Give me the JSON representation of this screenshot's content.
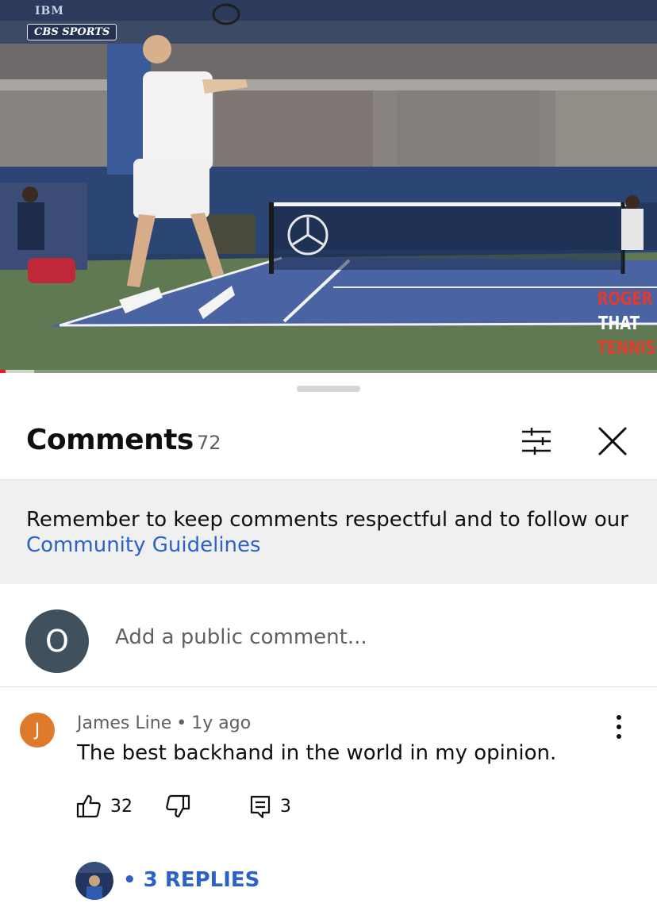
{
  "video": {
    "broadcaster_logo": "IBM",
    "network_bug": "CBS SPORTS",
    "watermark_lines": [
      "ROGER",
      "THAT",
      "TENNIS"
    ],
    "progress_played_fraction": 0.008,
    "progress_buffered_fraction": 0.052
  },
  "comments_panel": {
    "title": "Comments",
    "count": "72",
    "filter_icon": "sliders-icon",
    "close_icon": "close-icon",
    "notice": {
      "text": "Remember to keep comments respectful and to follow our",
      "link": "Community Guidelines"
    },
    "add_comment": {
      "avatar_initial": "O",
      "avatar_color": "#3f515e",
      "placeholder": "Add a public comment..."
    },
    "comments": [
      {
        "avatar_initial": "J",
        "avatar_color": "#e07a2b",
        "author": "James Line",
        "separator": "•",
        "time": "1y ago",
        "text": "The best backhand in the world in my opinion.",
        "likes": "32",
        "reply_count": "3",
        "replies_label": "• 3 REPLIES"
      }
    ]
  },
  "colors": {
    "link_blue": "#2a62c8",
    "progress_red": "#e31f1f",
    "notice_bg": "#f0f0f0"
  }
}
